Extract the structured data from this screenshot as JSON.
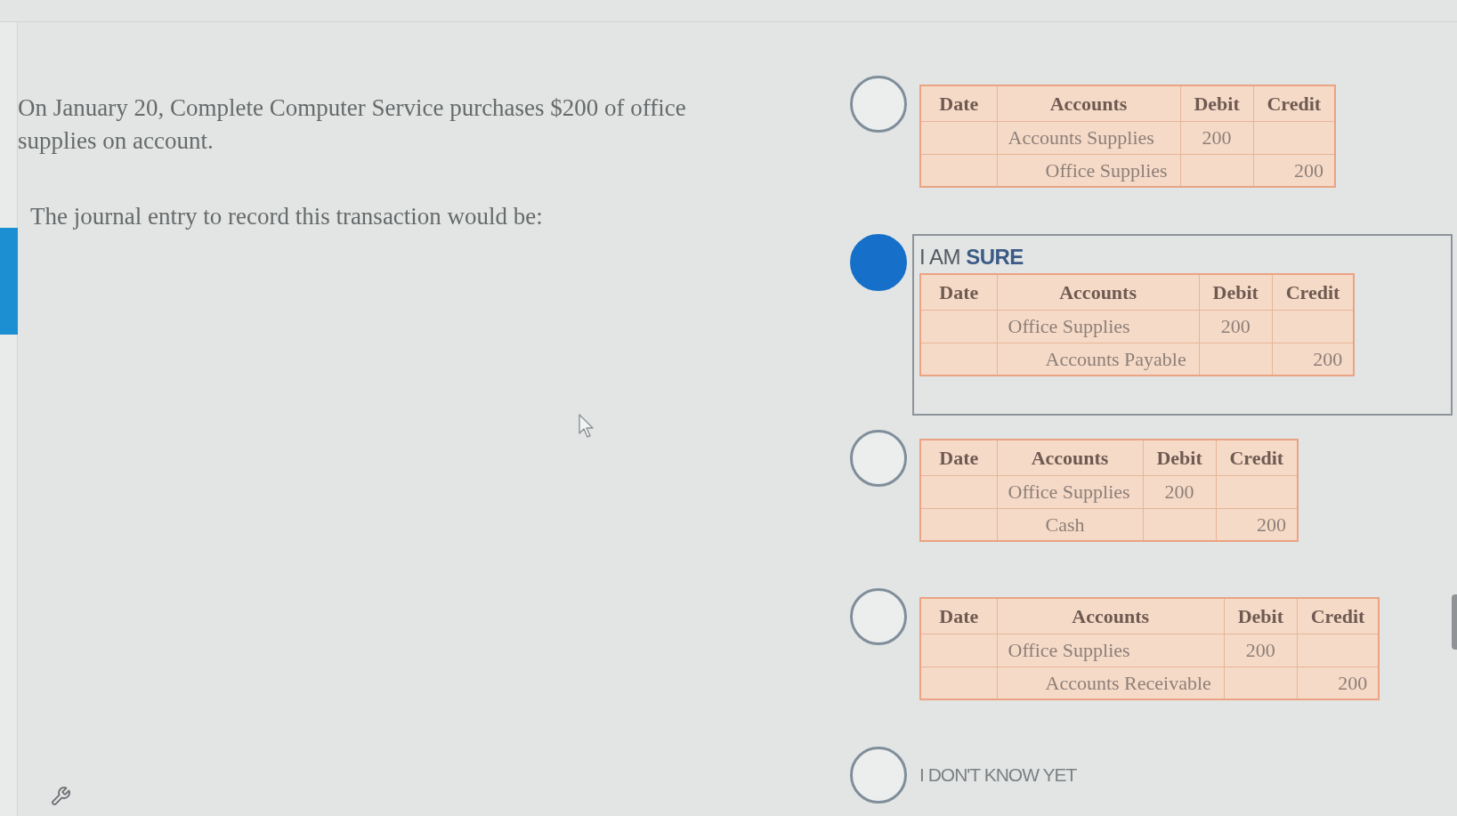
{
  "question": {
    "text": "On January 20, Complete Computer Service purchases $200 of office supplies on account.",
    "prompt": "The journal entry to record this transaction would be:"
  },
  "options": [
    {
      "kind": "journal",
      "selected": false,
      "table": {
        "columns": [
          "Date",
          "Accounts",
          "Debit",
          "Credit"
        ],
        "rows": [
          {
            "kind": "debit",
            "account": "Accounts Supplies",
            "debit": "200"
          },
          {
            "kind": "credit",
            "account": "Office Supplies",
            "credit": "200"
          }
        ]
      }
    },
    {
      "kind": "journal",
      "selected": true,
      "confidence_label": "I AM **SURE**",
      "table": {
        "columns": [
          "Date",
          "Accounts",
          "Debit",
          "Credit"
        ],
        "rows": [
          {
            "kind": "debit",
            "account": "Office Supplies",
            "debit": "200"
          },
          {
            "kind": "credit",
            "account": "Accounts Payable",
            "credit": "200"
          }
        ]
      }
    },
    {
      "kind": "journal",
      "selected": false,
      "table": {
        "columns": [
          "Date",
          "Accounts",
          "Debit",
          "Credit"
        ],
        "rows": [
          {
            "kind": "debit",
            "account": "Office Supplies",
            "debit": "200"
          },
          {
            "kind": "credit",
            "account": "Cash",
            "credit": "200"
          }
        ]
      }
    },
    {
      "kind": "journal",
      "selected": false,
      "table": {
        "columns": [
          "Date",
          "Accounts",
          "Debit",
          "Credit"
        ],
        "rows": [
          {
            "kind": "debit",
            "account": "Office Supplies",
            "debit": "200"
          },
          {
            "kind": "credit",
            "account": "Accounts Receivable",
            "credit": "200"
          }
        ]
      }
    },
    {
      "kind": "text",
      "selected": false,
      "label": "I DON'T KNOW YET"
    }
  ]
}
